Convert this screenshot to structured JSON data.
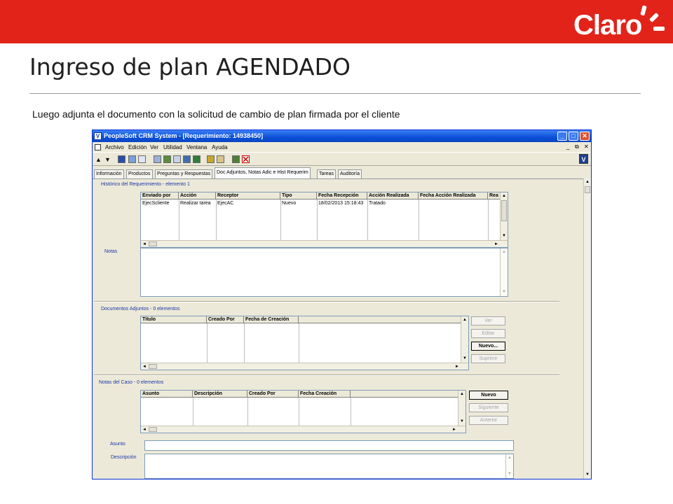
{
  "slide": {
    "brand": "Claro",
    "title": "Ingreso de plan AGENDADO",
    "subtitle": "Luego adjunta el documento con la solicitud de cambio de plan firmada por el cliente",
    "accent_color": "#e2231a"
  },
  "window": {
    "title": "PeopleSoft CRM System - [Requerimiento: 14938450]",
    "app_icon": "V",
    "controls": [
      "_",
      "□",
      "✕"
    ],
    "mdi_controls": [
      "_",
      "⧉",
      "✕"
    ]
  },
  "menubar": {
    "items": [
      "Archivo",
      "Edición",
      "Ver",
      "Utilidad",
      "Ventana",
      "Ayuda"
    ]
  },
  "toolbar": {
    "icons": [
      "arrow-up-icon",
      "arrow-down-icon",
      "save-icon",
      "copy-icon",
      "window-icon",
      "clipboard-icon",
      "check-icon",
      "document-icon",
      "tree-icon",
      "book-icon",
      "calendar-icon",
      "help-icon",
      "edit-icon",
      "delete-icon"
    ],
    "right_badge": "V"
  },
  "tabs": [
    {
      "label": "Información",
      "active": false
    },
    {
      "label": "Productos",
      "active": false
    },
    {
      "label": "Preguntas y Respuestas",
      "active": false
    },
    {
      "label": "Doc Adjuntos, Notas Adic e Hist Requerim",
      "active": true
    },
    {
      "label": "Tareas",
      "active": false
    },
    {
      "label": "Auditoría",
      "active": false
    }
  ],
  "historico": {
    "label": "Histórico del Requerimiento - elemento 1",
    "columns": [
      "Enviado por",
      "Acción",
      "Receptor",
      "Tipo",
      "Fecha Recepción",
      "Acción Realizada",
      "Fecha Acción Realizada",
      "Rea"
    ],
    "rows": [
      [
        "EjecScliente",
        "Realizar tarea",
        "EjecAC",
        "Nuevo",
        "18/02/2013 15:18:43",
        "Tratado",
        "",
        ""
      ]
    ]
  },
  "notas": {
    "label": "Notas"
  },
  "documentos": {
    "label": "Documentos Adjuntos - 0 elementos",
    "columns": [
      "Título",
      "Creado Por",
      "Fecha de Creación"
    ],
    "buttons": [
      {
        "label": "Ver",
        "enabled": false
      },
      {
        "label": "Editar",
        "enabled": false
      },
      {
        "label": "Nuevo...",
        "enabled": true
      },
      {
        "label": "Suprimir",
        "enabled": false
      }
    ]
  },
  "notas_caso": {
    "label": "Notas del Caso - 0 elementos",
    "columns": [
      "Asunto",
      "Descripción",
      "Creado Por",
      "Fecha Creación"
    ],
    "buttons": [
      {
        "label": "Nuevo",
        "enabled": true
      },
      {
        "label": "Siguiente",
        "enabled": false
      },
      {
        "label": "Anterior",
        "enabled": false
      }
    ]
  },
  "form": {
    "asunto_label": "Asunto",
    "asunto_value": "",
    "descripcion_label": "Descripción",
    "descripcion_value": ""
  }
}
